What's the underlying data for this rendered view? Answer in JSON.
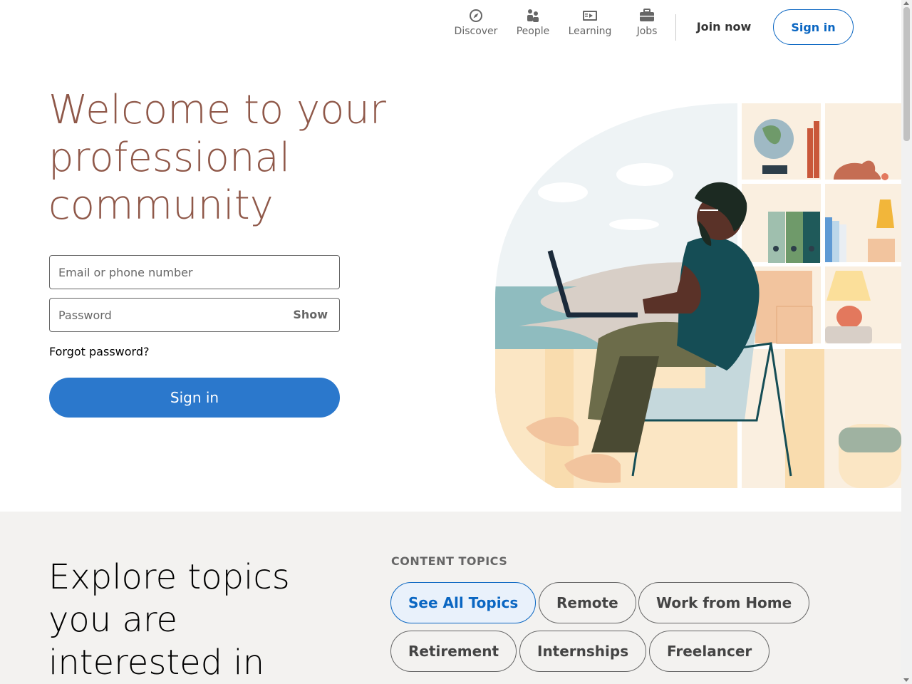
{
  "nav": {
    "items": [
      {
        "label": "Discover",
        "icon": "compass-icon"
      },
      {
        "label": "People",
        "icon": "people-icon"
      },
      {
        "label": "Learning",
        "icon": "learning-icon"
      },
      {
        "label": "Jobs",
        "icon": "briefcase-icon"
      }
    ],
    "join_label": "Join now",
    "signin_label": "Sign in"
  },
  "hero": {
    "title": "Welcome to your professional community",
    "email_placeholder": "Email or phone number",
    "password_placeholder": "Password",
    "show_label": "Show",
    "forgot_label": "Forgot password?",
    "signin_label": "Sign in"
  },
  "topics": {
    "title": "Explore topics you are interested in",
    "label": "CONTENT TOPICS",
    "pills": [
      "See All Topics",
      "Remote",
      "Work from Home",
      "Retirement",
      "Internships",
      "Freelancer"
    ]
  },
  "colors": {
    "brand": "#0a66c2",
    "signin_button": "#2b78cc",
    "hero_title": "#8f5849",
    "section_bg": "#f3f2f0"
  }
}
